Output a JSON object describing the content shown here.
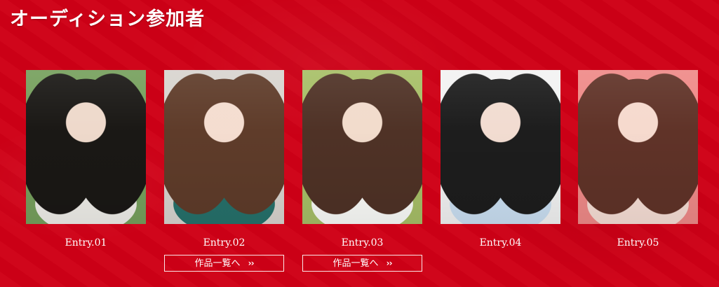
{
  "page": {
    "title": "オーディション参加者",
    "background_color": "#cf0016"
  },
  "entries": [
    {
      "label": "Entry.01",
      "photo_icon": "portrait-photo",
      "photo_colors": {
        "background": "#76a05d",
        "hair": "#171313",
        "cloth": "#f4f2ef"
      },
      "works_button_label": ""
    },
    {
      "label": "Entry.02",
      "photo_icon": "portrait-photo",
      "photo_colors": {
        "background": "#d8d4cf",
        "hair": "#5b3624",
        "cloth": "#1f6e67"
      },
      "works_button_label": "作品一覧へ"
    },
    {
      "label": "Entry.03",
      "photo_icon": "portrait-photo",
      "photo_colors": {
        "background": "#a7bf67",
        "hair": "#4c2d24",
        "cloth": "#ffffff"
      },
      "works_button_label": "作品一覧へ"
    },
    {
      "label": "Entry.04",
      "photo_icon": "portrait-photo",
      "photo_colors": {
        "background": "#f2f2f2",
        "hair": "#151515",
        "cloth": "#c9dff2"
      },
      "works_button_label": ""
    },
    {
      "label": "Entry.05",
      "photo_icon": "portrait-photo",
      "photo_colors": {
        "background": "#ef8a88",
        "hair": "#5b3025",
        "cloth": "#f7e2d9"
      },
      "works_button_label": ""
    }
  ],
  "button_icon": "double-chevron-right-icon"
}
